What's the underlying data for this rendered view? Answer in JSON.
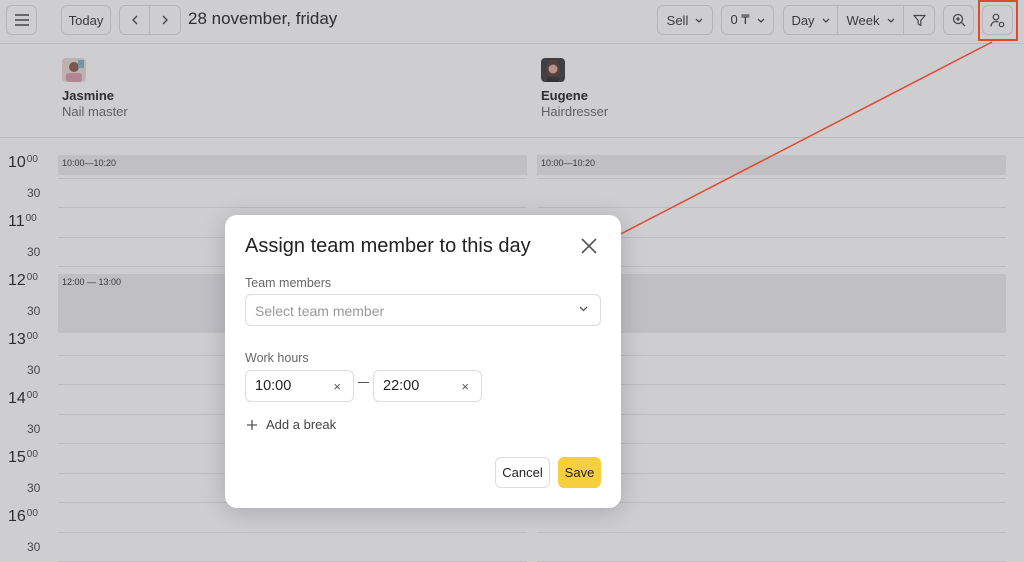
{
  "toolbar": {
    "today_label": "Today",
    "date_label": "28 november, friday",
    "sell_label": "Sell",
    "balance_label": "0 ₸",
    "day_label": "Day",
    "week_label": "Week"
  },
  "staff": [
    {
      "name": "Jasmine",
      "role": "Nail master"
    },
    {
      "name": "Eugene",
      "role": "Hairdresser"
    }
  ],
  "time_axis": {
    "hours": [
      "10",
      "11",
      "12",
      "13",
      "14",
      "15",
      "16"
    ],
    "minutes_suffix": "00",
    "half_label": "30"
  },
  "slots": {
    "jasmine_1": "10:00—10:20",
    "jasmine_2": "12:00 — 13:00",
    "eugene_1": "10:00—10:20"
  },
  "modal": {
    "title": "Assign team member to this day",
    "team_label": "Team members",
    "team_placeholder": "Select team member",
    "hours_label": "Work hours",
    "start_time": "10:00",
    "end_time": "22:00",
    "clear_glyph": "×",
    "add_break_label": "Add a break",
    "cancel_label": "Cancel",
    "save_label": "Save"
  },
  "colors": {
    "accent": "#f6cf3f",
    "highlight": "#e2482d"
  }
}
